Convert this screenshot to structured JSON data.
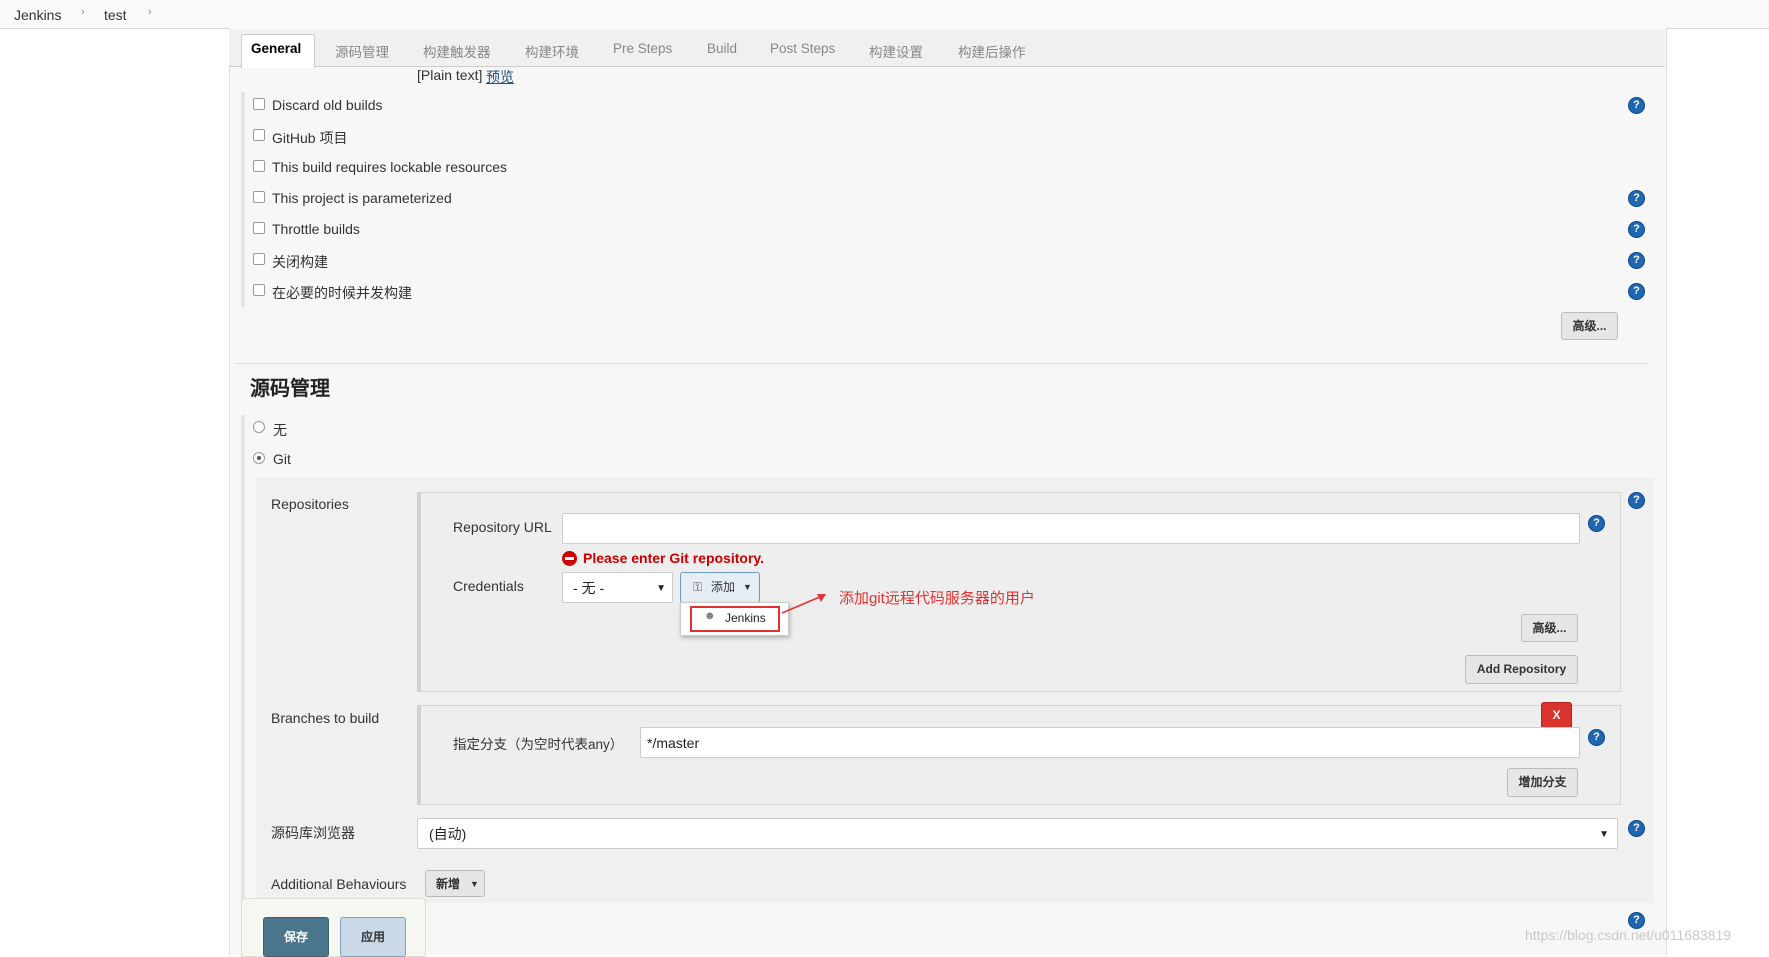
{
  "breadcrumb": {
    "items": [
      "Jenkins",
      "test"
    ]
  },
  "tabs": [
    "General",
    "源码管理",
    "构建触发器",
    "构建环境",
    "Pre Steps",
    "Build",
    "Post Steps",
    "构建设置",
    "构建后操作"
  ],
  "description_format": {
    "plain_text": "[Plain text]",
    "preview_link": "预览"
  },
  "general_options": [
    "Discard old builds",
    "GitHub 项目",
    "This build requires lockable resources",
    "This project is parameterized",
    "Throttle builds",
    "关闭构建",
    "在必要的时候并发构建"
  ],
  "general_advanced_button": "高级...",
  "scm": {
    "title": "源码管理",
    "options": [
      "无",
      "Git"
    ],
    "selected": "Git",
    "repositories_label": "Repositories",
    "repository_url_label": "Repository URL",
    "repository_url_value": "",
    "error_text": "Please enter Git repository.",
    "credentials_label": "Credentials",
    "credentials_value": "- 无 -",
    "add_button": "添加",
    "add_dropdown_item": "Jenkins",
    "annotation_text": "添加git远程代码服务器的用户",
    "advanced_button": "高级...",
    "add_repository_button": "Add Repository",
    "branches_label": "Branches to build",
    "delete_button": "X",
    "branch_specifier_label": "指定分支（为空时代表any）",
    "branch_specifier_value": "*/master",
    "add_branch_button": "增加分支",
    "repo_browser_label": "源码库浏览器",
    "repo_browser_value": "(自动)",
    "additional_behaviours_label": "Additional Behaviours",
    "new_button": "新增"
  },
  "footer": {
    "save_button": "保存",
    "apply_button": "应用"
  },
  "watermark": "https://blog.csdn.net/u011683819",
  "colors": {
    "error": "#cc0000",
    "save": "#4b758b",
    "annotation": "#e83030"
  }
}
